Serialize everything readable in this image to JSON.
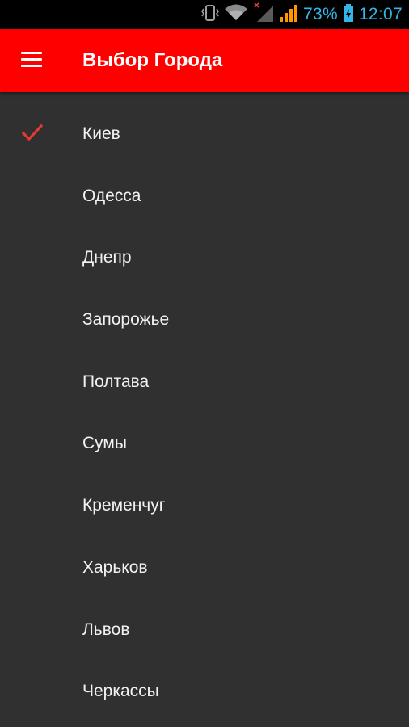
{
  "status_bar": {
    "battery_percent": "73%",
    "time": "12:07",
    "icons": [
      "vibrate-icon",
      "wifi-icon",
      "no-signal-sim1-icon",
      "signal-icon",
      "battery-charging-icon"
    ],
    "accent_color": "#33b5e5"
  },
  "app_bar": {
    "title": "Выбор Города",
    "menu_icon": "hamburger-menu-icon",
    "color": "#ff0000"
  },
  "cities": {
    "selected_index": 0,
    "check_icon": "checkmark-icon",
    "check_color": "#e53935",
    "items": [
      {
        "label": "Киев"
      },
      {
        "label": "Одесса"
      },
      {
        "label": "Днепр"
      },
      {
        "label": "Запорожье"
      },
      {
        "label": "Полтава"
      },
      {
        "label": "Сумы"
      },
      {
        "label": "Кременчуг"
      },
      {
        "label": "Харьков"
      },
      {
        "label": "Львов"
      },
      {
        "label": "Черкассы"
      }
    ]
  }
}
